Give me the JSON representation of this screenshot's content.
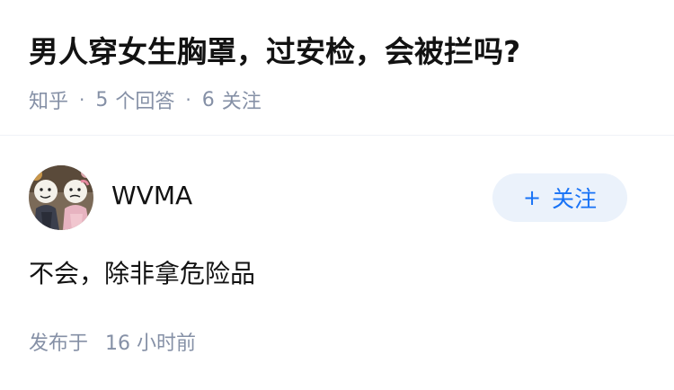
{
  "question": {
    "title": "男人穿女生胸罩，过安检，会被拦吗?",
    "source": "知乎",
    "answer_count": "5",
    "answer_label": "个回答",
    "follower_count": "6",
    "follower_label": "关注",
    "meta_separator": "·"
  },
  "answer": {
    "author": {
      "name": "WVMA",
      "avatar_icon": "meme-faces-avatar"
    },
    "follow_button": {
      "icon": "+",
      "label": "关注"
    },
    "content": "不会，除非拿危险品",
    "published_label": "发布于",
    "published_time": "16 小时前"
  },
  "colors": {
    "title": "#121212",
    "meta": "#8590a6",
    "follow_bg": "#ebf2fb",
    "follow_text": "#1772f6",
    "divider": "#f0f2f7"
  }
}
